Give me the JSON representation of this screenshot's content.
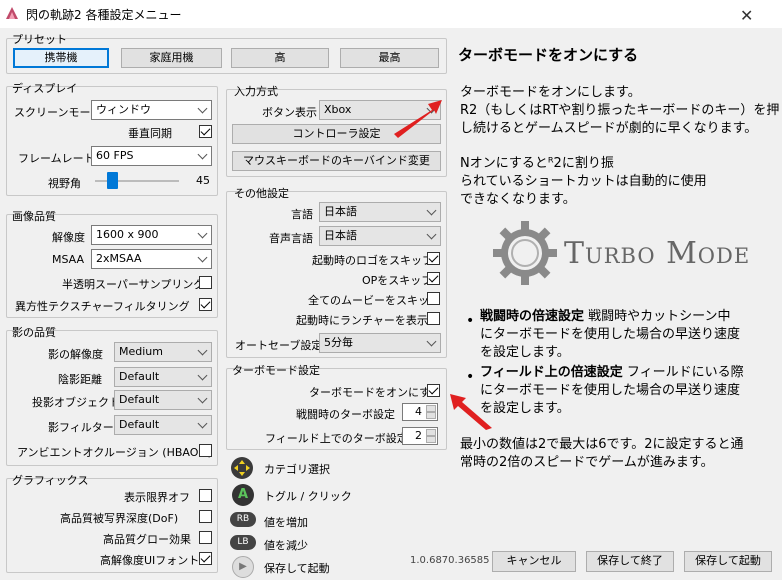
{
  "window": {
    "title": "閃の軌跡2 各種設定メニュー",
    "close": "✕"
  },
  "preset": {
    "title": "プリセット",
    "buttons": [
      "携帯機",
      "家庭用機",
      "高",
      "最高"
    ]
  },
  "display": {
    "title": "ディスプレイ",
    "screen_mode_label": "スクリーンモード",
    "screen_mode_value": "ウィンドウ",
    "vsync_label": "垂直同期",
    "framerate_label": "フレームレート",
    "framerate_value": "60 FPS",
    "fov_label": "視野角",
    "fov_value": "45"
  },
  "image_quality": {
    "title": "画像品質",
    "resolution_label": "解像度",
    "resolution_value": "1600 x 900",
    "msaa_label": "MSAA",
    "msaa_value": "2xMSAA",
    "supersampling_label": "半透明スーパーサンプリング",
    "aniso_label": "異方性テクスチャーフィルタリング"
  },
  "shadow_quality": {
    "title": "影の品質",
    "resolution_label": "影の解像度",
    "resolution_value": "Medium",
    "distance_label": "陰影距離",
    "distance_value": "Default",
    "objects_label": "投影オブジェクト",
    "objects_value": "Default",
    "filter_label": "影フィルター",
    "filter_value": "Default",
    "ao_label": "アンビエントオクルージョン (HBAO+)"
  },
  "graphics": {
    "title": "グラフィックス",
    "draw_distance_label": "表示限界オフ",
    "dof_label": "高品質被写界深度(DoF)",
    "glow_label": "高品質グロー効果",
    "hires_ui_label": "高解像度UIフォント"
  },
  "input": {
    "title": "入力方式",
    "button_display_label": "ボタン表示",
    "button_display_value": "Xbox",
    "controller_button": "コントローラ設定",
    "keybind_button": "マウスキーボードのキーバインド変更"
  },
  "other": {
    "title": "その他設定",
    "language_label": "言語",
    "language_value": "日本語",
    "voice_label": "音声言語",
    "voice_value": "日本語",
    "skip_logos_label": "起動時のロゴをスキップ",
    "skip_op_label": "OPをスキップ",
    "skip_movies_label": "全てのムービーをスキップ",
    "launcher_label": "起動時にランチャーを表示",
    "autosave_label": "オートセーブ設定",
    "autosave_value": "5分毎"
  },
  "turbo": {
    "title": "ターボモード設定",
    "enable_label": "ターボモードをオンにする",
    "battle_label": "戦闘時のターボ設定",
    "battle_value": "4",
    "field_label": "フィールド上でのターボ設定",
    "field_value": "2"
  },
  "legend": {
    "items": [
      {
        "glyph": "✥",
        "text": "カテゴリ選択"
      },
      {
        "glyph": "A",
        "text": "トグル / クリック"
      },
      {
        "glyph": "RB",
        "text": "値を増加"
      },
      {
        "glyph": "LB",
        "text": "値を減少"
      },
      {
        "glyph": "▶",
        "text": "保存して起動"
      }
    ]
  },
  "help": {
    "heading": "ターボモードをオンにする",
    "p1_line1": "ターボモードをオンにします。",
    "p1_line2": "R2（もしくはRTや割り振ったキーボードのキー）を押",
    "p1_line3": "し続けるとゲームスピードが劇的に早くなります。",
    "p2_line1": "Nオンにするとᴿ2に割り振",
    "p2_line2": "られているショートカットは自動的に使用",
    "p2_line3": "できなくなります。",
    "logo_text": "Turbo Mode",
    "b1_bold": "戦闘時の倍速設定",
    "b1_line1": " 戦闘時やカットシーン中",
    "b1_line2": "にターボモードを使用した場合の早送り速度",
    "b1_line3": "を設定します。",
    "b2_bold": "フィールド上の倍速設定",
    "b2_line1": " フィールドにいる際",
    "b2_line2": "にターボモードを使用した場合の早送り速度",
    "b2_line3": "を設定します。",
    "p3_line1": "最小の数値は2で最大は6です。2に設定すると通",
    "p3_line2": "常時の2倍のスピードでゲームが進みます。"
  },
  "footer": {
    "version": "1.0.6870.36585",
    "cancel": "キャンセル",
    "save_exit": "保存して終了",
    "save_launch": "保存して起動"
  }
}
